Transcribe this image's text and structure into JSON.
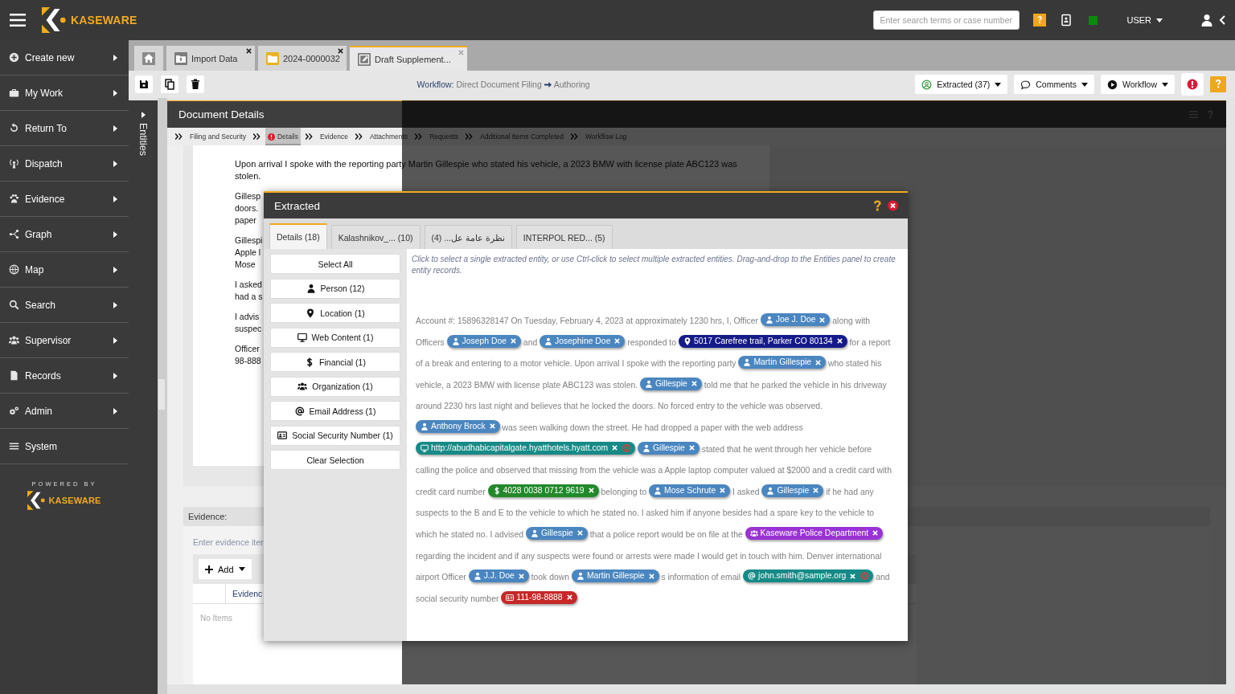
{
  "topbar": {
    "logo": "KASEWARE",
    "search": {
      "placeholder": "Enter search terms or case number"
    },
    "user": "USER"
  },
  "sidebar": {
    "items": [
      {
        "label": "Create new",
        "has_submenu": true
      },
      {
        "label": "My Work",
        "has_submenu": true
      },
      {
        "label": "Return To",
        "has_submenu": true
      },
      {
        "label": "Dispatch",
        "has_submenu": true
      },
      {
        "label": "Evidence",
        "has_submenu": true
      },
      {
        "label": "Graph",
        "has_submenu": true
      },
      {
        "label": "Map",
        "has_submenu": true
      },
      {
        "label": "Search",
        "has_submenu": true
      },
      {
        "label": "Supervisor",
        "has_submenu": true
      },
      {
        "label": "Records",
        "has_submenu": true
      },
      {
        "label": "Admin",
        "has_submenu": true
      },
      {
        "label": "System",
        "has_submenu": false
      }
    ],
    "powered_by": "POWERED BY",
    "logo": "KASEWARE"
  },
  "entities_panel": {
    "label": "Entities"
  },
  "tabs": [
    {
      "kind": "home",
      "selected": false
    },
    {
      "kind": "import",
      "label": "Import Data",
      "selected": false
    },
    {
      "kind": "case",
      "label": "2024-0000032",
      "selected": false
    },
    {
      "kind": "draft",
      "label": "Draft Supplement...",
      "selected": true
    }
  ],
  "toolbar": {
    "workflow": {
      "label": "Workflow:",
      "from": "Direct Document Filing",
      "to": "Authoring"
    },
    "buttons": [
      {
        "kind": "extracted",
        "label": "Extracted (37)"
      },
      {
        "kind": "comments",
        "label": "Comments"
      },
      {
        "kind": "workflow",
        "label": "Workflow"
      },
      {
        "kind": "alert"
      },
      {
        "kind": "help"
      }
    ]
  },
  "document": {
    "title": "Document Details",
    "steps": [
      {
        "label": "Filing and Security",
        "selected": false,
        "error": false
      },
      {
        "label": "Details",
        "selected": true,
        "error": true
      },
      {
        "label": "Evidence",
        "selected": false,
        "error": false
      },
      {
        "label": "Attachments",
        "selected": false,
        "error": false
      },
      {
        "label": "Requests",
        "selected": false,
        "error": false
      },
      {
        "label": "Additional Items Completed",
        "selected": false,
        "error": false
      },
      {
        "label": "Workflow Log",
        "selected": false,
        "error": false
      }
    ],
    "lead_paragraph": "Upon arrival I spoke with the reporting party Martin Gillespie who stated his vehicle, a 2023 BMW with license plate ABC123 was stolen.",
    "paragraphs": [
      {
        "lines": [
          "Gillesp",
          "doors.",
          "paper"
        ]
      },
      {
        "lines": [
          "Gillespi",
          "Apple l",
          "Mose"
        ]
      },
      {
        "lines": [
          "I asked",
          "had a s"
        ]
      },
      {
        "lines": [
          "I advis",
          "suspec"
        ]
      },
      {
        "lines": [
          "Officer",
          "98-888"
        ]
      }
    ],
    "evidence": {
      "title": "Evidence:",
      "hint": "Enter evidence iter",
      "add_button": "Add",
      "columns": [
        "Evidenc"
      ],
      "empty_text": "No Items"
    }
  },
  "dialog": {
    "title": "Extracted",
    "tabs": [
      {
        "label": "Details (18)",
        "selected": true
      },
      {
        "label": "Kalashnikov_... (10)",
        "selected": false
      },
      {
        "label": "نظرة عامة عل... (4)",
        "selected": false
      },
      {
        "label": "INTERPOL RED... (5)",
        "selected": false
      }
    ],
    "filters": [
      {
        "kind": "all",
        "label": "Select All"
      },
      {
        "kind": "person",
        "label": "Person (12)"
      },
      {
        "kind": "location",
        "label": "Location (1)"
      },
      {
        "kind": "web",
        "label": "Web Content (1)"
      },
      {
        "kind": "financial",
        "label": "Financial (1)"
      },
      {
        "kind": "organization",
        "label": "Organization (1)"
      },
      {
        "kind": "email",
        "label": "Email Address (1)"
      },
      {
        "kind": "ssn",
        "label": "Social Security Number (1)"
      },
      {
        "kind": "clear",
        "label": "Clear Selection"
      }
    ],
    "hint": "Click to select a single extracted entity, or use Ctrl-click to select multiple extracted entities. Drag-and-drop to the Entities panel to create entity records.",
    "segments": [
      {
        "kind": "text",
        "text": "Account #: 15896328147 On Tuesday, February 4, 2023 at approximately 1230 hrs, I, Officer"
      },
      {
        "kind": "person",
        "text": "Joe J. Doe",
        "color": "#4a86c0",
        "flagged": false
      },
      {
        "kind": "text",
        "text": "along with Officers"
      },
      {
        "kind": "person",
        "text": "Joseph Doe",
        "color": "#4a86c0",
        "flagged": false
      },
      {
        "kind": "text",
        "text": "and"
      },
      {
        "kind": "person",
        "text": "Josephine Doe",
        "color": "#4a86c0",
        "flagged": false
      },
      {
        "kind": "text",
        "text": "responded to"
      },
      {
        "kind": "location",
        "text": "5017 Carefree trail, Parker CO 80134",
        "color": "#151a8a",
        "flagged": false
      },
      {
        "kind": "text",
        "text": "for a report of a break and entering to a motor vehicle. Upon arrival I spoke with the reporting party"
      },
      {
        "kind": "person",
        "text": "Martin Gillespie",
        "color": "#4a86c0",
        "flagged": false
      },
      {
        "kind": "text",
        "text": "who stated his vehicle, a 2023 BMW with license plate ABC123 was stolen."
      },
      {
        "kind": "person",
        "text": "Gillespie",
        "color": "#4a86c0",
        "flagged": false
      },
      {
        "kind": "text",
        "text": "told me that he parked the vehicle in his driveway around 2230 hrs last night and believes that he locked the doors. No forced entry to the vehicle was observed."
      },
      {
        "kind": "person",
        "text": "Anthony Brock",
        "color": "#4a86c0",
        "flagged": false
      },
      {
        "kind": "text",
        "text": "was seen walking down the street. He had dropped a paper with the web address"
      },
      {
        "kind": "web",
        "text": "http://abudhabicapitalgate.hyatthotels.hyatt.com",
        "color": "#168a86",
        "flagged": true
      },
      {
        "kind": "person",
        "text": "Gillespie",
        "color": "#4a86c0",
        "flagged": false
      },
      {
        "kind": "text",
        "text": "stated that he went through her vehicle before calling the police and observed that missing from the vehicle was a Apple laptop computer valued at $2000 and a credit card with credit card number"
      },
      {
        "kind": "financial",
        "text": "4028 0038 0712 9619",
        "color": "#22892a",
        "flagged": false
      },
      {
        "kind": "text",
        "text": "belonging to"
      },
      {
        "kind": "person",
        "text": "Mose Schrute",
        "color": "#4a86c0",
        "flagged": false
      },
      {
        "kind": "text",
        "text": "I asked"
      },
      {
        "kind": "person",
        "text": "Gillespie",
        "color": "#4a86c0",
        "flagged": false
      },
      {
        "kind": "text",
        "text": "if he had any suspects to the B and E to the vehicle to which he stated no. I asked him if anyone besides had a spare key to the vehicle to which he stated no. I advised"
      },
      {
        "kind": "person",
        "text": "Gillespie",
        "color": "#4a86c0",
        "flagged": false
      },
      {
        "kind": "text",
        "text": "that a police report would be on file at the"
      },
      {
        "kind": "organization",
        "text": "Kaseware Police Department",
        "color": "#9a32d4",
        "flagged": false
      },
      {
        "kind": "text",
        "text": "regarding the incident and if any suspects were found or arrests were made I would get in touch with him. Denver international airport Officer"
      },
      {
        "kind": "person",
        "text": "J.J. Doe",
        "color": "#4a86c0",
        "flagged": false
      },
      {
        "kind": "text",
        "text": "took down"
      },
      {
        "kind": "person",
        "text": "Martin Gillespie",
        "color": "#4a86c0",
        "flagged": false
      },
      {
        "kind": "text",
        "text": "s information of email"
      },
      {
        "kind": "email",
        "text": "john.smith@sample.org",
        "color": "#168a86",
        "flagged": true
      },
      {
        "kind": "text",
        "text": "and social security number"
      },
      {
        "kind": "ssn",
        "text": "111-98-8888",
        "color": "#c62828",
        "flagged": false
      }
    ]
  }
}
